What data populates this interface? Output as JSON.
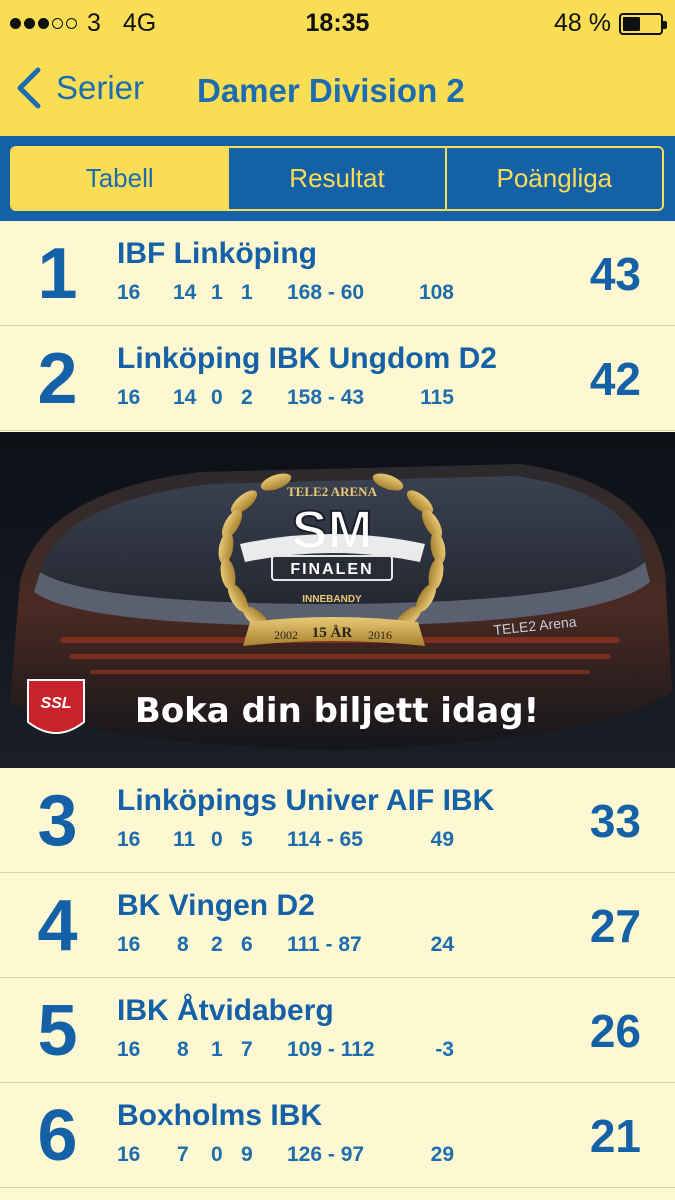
{
  "status_bar": {
    "signal_dots_filled": 3,
    "signal_dots_total": 5,
    "carrier": "3",
    "network": "4G",
    "time": "18:35",
    "battery": "48 %",
    "battery_level": 0.48
  },
  "nav": {
    "back_label": "Serier",
    "title": "Damer Division 2"
  },
  "tabs": [
    {
      "label": "Tabell",
      "active": true
    },
    {
      "label": "Resultat",
      "active": false
    },
    {
      "label": "Poängliga",
      "active": false
    }
  ],
  "standings": [
    {
      "rank": "1",
      "team": "IBF Linköping",
      "gp": "16",
      "w": "14",
      "d": "1",
      "l": "1",
      "goals": "168 - 60",
      "diff": "108",
      "points": "43"
    },
    {
      "rank": "2",
      "team": "Linköping IBK Ungdom D2",
      "gp": "16",
      "w": "14",
      "d": "0",
      "l": "2",
      "goals": "158 - 43",
      "diff": "115",
      "points": "42"
    },
    {
      "rank": "3",
      "team": "Linköpings Univer AIF IBK",
      "gp": "16",
      "w": "11",
      "d": "0",
      "l": "5",
      "goals": "114 - 65",
      "diff": "49",
      "points": "33"
    },
    {
      "rank": "4",
      "team": "BK Vingen D2",
      "gp": "16",
      "w": "8",
      "d": "2",
      "l": "6",
      "goals": "111 - 87",
      "diff": "24",
      "points": "27"
    },
    {
      "rank": "5",
      "team": "IBK Åtvidaberg",
      "gp": "16",
      "w": "8",
      "d": "1",
      "l": "7",
      "goals": "109 - 112",
      "diff": "-3",
      "points": "26"
    },
    {
      "rank": "6",
      "team": "Boxholms IBK",
      "gp": "16",
      "w": "7",
      "d": "0",
      "l": "9",
      "goals": "126 - 97",
      "diff": "29",
      "points": "21"
    }
  ],
  "ad": {
    "arena_text": "TELE2 ARENA",
    "badge_title": "SM",
    "badge_ribbon": "FINALEN",
    "badge_sub": "INNEBANDY",
    "badge_years_left": "2002",
    "badge_years_mid": "15 ÅR",
    "badge_years_right": "2016",
    "logo_text": "SSL",
    "slogan": "Boka din biljett idag!",
    "building_sign": "TELE2 Arena"
  },
  "colors": {
    "yellow": "#f9dd55",
    "blue": "#1561a8",
    "row_bg": "#fdf8d2",
    "gold": "#c9a54a"
  }
}
